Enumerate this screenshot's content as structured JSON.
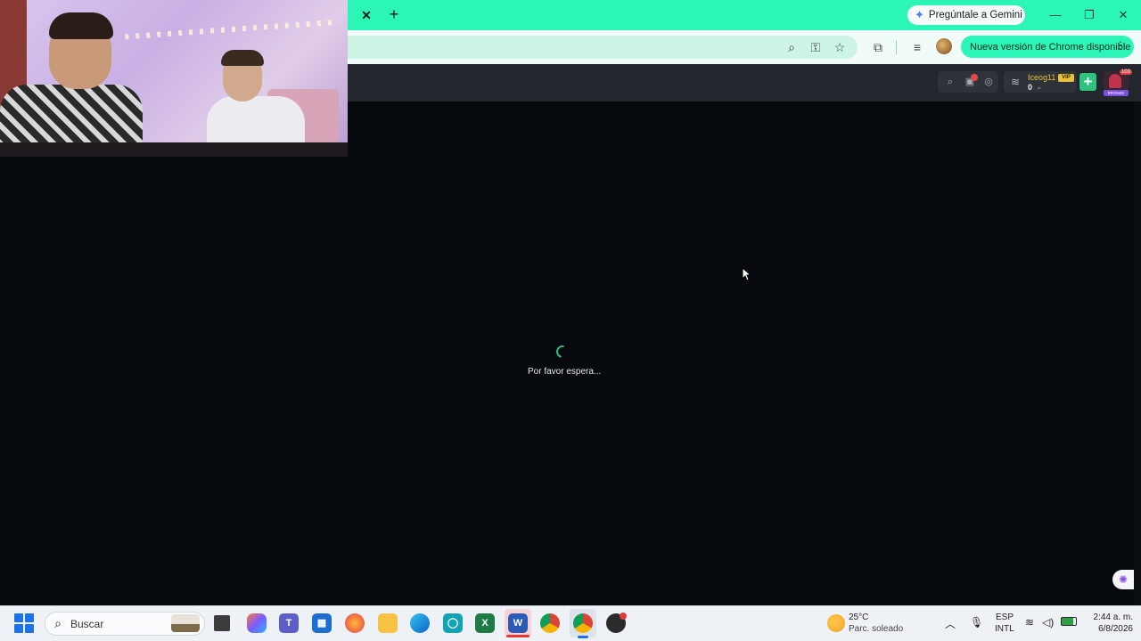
{
  "browser": {
    "gemini_button": "Pregúntale a Gemini",
    "update_notice": "Nueva versión de Chrome disponible"
  },
  "site": {
    "username": "Iceog11",
    "vip_badge": "VIP",
    "balance": "0",
    "level": "103",
    "rank": "BRONZE"
  },
  "main": {
    "loading_text": "Por favor espera..."
  },
  "taskbar": {
    "search_placeholder": "Buscar",
    "weather_temp": "25°C",
    "weather_desc": "Parc. soleado",
    "lang_top": "ESP",
    "lang_bottom": "INTL",
    "time": "2:44 a. m.",
    "date": "6/8/2026"
  },
  "colors": {
    "tab_strip": "#2cf5b8",
    "accent_green": "#2ec27e",
    "page_bg": "#06090d",
    "vip_gold": "#e8c23a"
  },
  "icons": [
    "search-icon",
    "gift-icon",
    "support-icon",
    "coins-icon",
    "plus-icon",
    "zoom-icon",
    "key-icon",
    "star-icon",
    "extensions-icon",
    "media-icon",
    "windows-icon"
  ]
}
